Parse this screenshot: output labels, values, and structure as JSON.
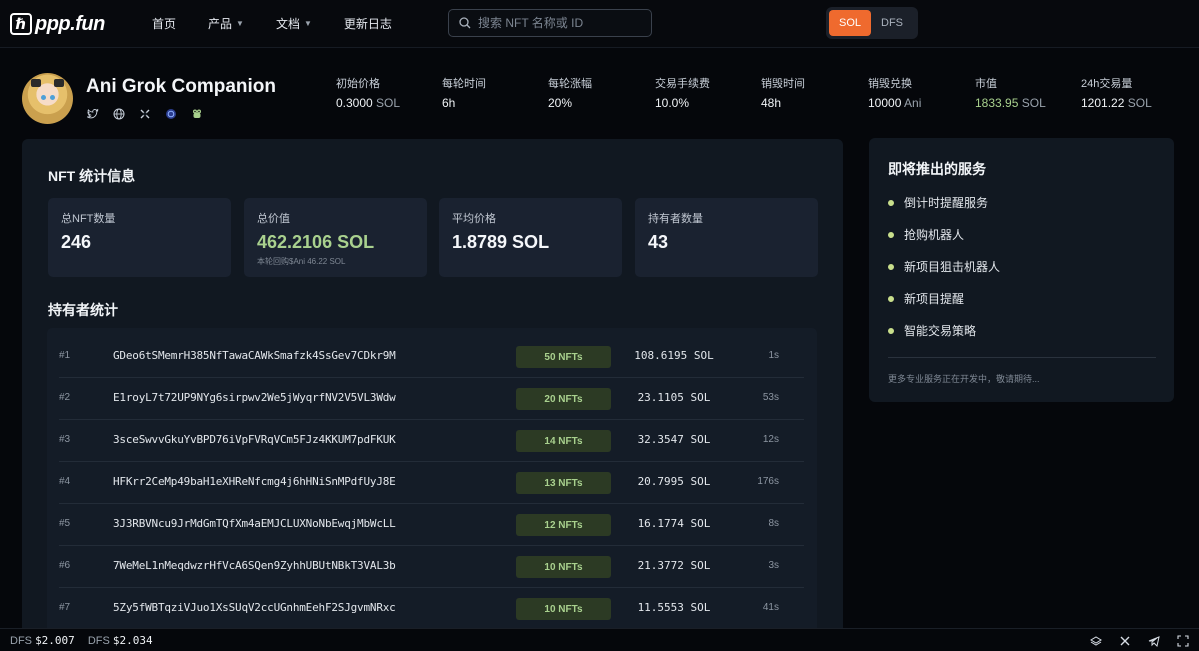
{
  "header": {
    "logo_mark": "ℏ",
    "logo_text": "ppp.fun",
    "nav": [
      {
        "label": "首页",
        "has_dropdown": false
      },
      {
        "label": "产品",
        "has_dropdown": true
      },
      {
        "label": "文档",
        "has_dropdown": true
      },
      {
        "label": "更新日志",
        "has_dropdown": false
      }
    ],
    "search_placeholder": "搜索 NFT 名称或 ID",
    "currency_toggle": {
      "options": [
        "SOL",
        "DFS"
      ],
      "selected": "SOL"
    }
  },
  "project": {
    "name": "Ani Grok Companion",
    "social_icons": [
      "twitter-icon",
      "globe-icon",
      "x-icon",
      "token-icon",
      "frog-icon"
    ],
    "stats": [
      {
        "label": "初始价格",
        "value": "0.3000",
        "unit": "SOL"
      },
      {
        "label": "每轮时间",
        "value": "6h",
        "unit": ""
      },
      {
        "label": "每轮涨幅",
        "value": "20%",
        "unit": ""
      },
      {
        "label": "交易手续费",
        "value": "10.0%",
        "unit": ""
      },
      {
        "label": "销毁时间",
        "value": "48h",
        "unit": ""
      },
      {
        "label": "销毁兑换",
        "value": "10000",
        "unit": "Ani"
      },
      {
        "label": "市值",
        "value": "1833.95",
        "unit": "SOL",
        "accent": true
      },
      {
        "label": "24h交易量",
        "value": "1201.22",
        "unit": "SOL"
      }
    ]
  },
  "nft_stats": {
    "title": "NFT 统计信息",
    "cards": [
      {
        "label": "总NFT数量",
        "value": "246",
        "sub": ""
      },
      {
        "label": "总价值",
        "value": "462.2106 SOL",
        "sub": "本轮回购$Ani 46.22 SOL",
        "accent": true
      },
      {
        "label": "平均价格",
        "value": "1.8789 SOL",
        "sub": ""
      },
      {
        "label": "持有者数量",
        "value": "43",
        "sub": ""
      }
    ]
  },
  "holders": {
    "title": "持有者统计",
    "rows": [
      {
        "rank": "#1",
        "address": "GDeo6tSMemrH385NfTawaCAWkSmafzk4SsGev7CDkr9M",
        "nfts": "50 NFTs",
        "sol": "108.6195 SOL",
        "time": "1s"
      },
      {
        "rank": "#2",
        "address": "E1royL7t72UP9NYg6sirpwv2We5jWyqrfNV2V5VL3Wdw",
        "nfts": "20 NFTs",
        "sol": "23.1105 SOL",
        "time": "53s"
      },
      {
        "rank": "#3",
        "address": "3sceSwvvGkuYvBPD76iVpFVRqVCm5FJz4KKUM7pdFKUK",
        "nfts": "14 NFTs",
        "sol": "32.3547 SOL",
        "time": "12s"
      },
      {
        "rank": "#4",
        "address": "HFKrr2CeMp49baH1eXHReNfcmg4j6hHNiSnMPdfUyJ8E",
        "nfts": "13 NFTs",
        "sol": "20.7995 SOL",
        "time": "176s"
      },
      {
        "rank": "#5",
        "address": "3J3RBVNcu9JrMdGmTQfXm4aEMJCLUXNoNbEwqjMbWcLL",
        "nfts": "12 NFTs",
        "sol": "16.1774 SOL",
        "time": "8s"
      },
      {
        "rank": "#6",
        "address": "7WeMeL1nMeqdwzrHfVcA6SQen9ZyhhUBUtNBkT3VAL3b",
        "nfts": "10 NFTs",
        "sol": "21.3772 SOL",
        "time": "3s"
      },
      {
        "rank": "#7",
        "address": "5Zy5fWBTqziVJuo1XsSUqV2ccUGnhmEehF2SJgvmNRxc",
        "nfts": "10 NFTs",
        "sol": "11.5553 SOL",
        "time": "41s"
      }
    ]
  },
  "upcoming": {
    "title": "即将推出的服务",
    "services": [
      "倒计时提醒服务",
      "抢购机器人",
      "新项目狙击机器人",
      "新项目提醒",
      "智能交易策略"
    ],
    "note": "更多专业服务正在开发中，敬请期待..."
  },
  "footer": {
    "tickers": [
      {
        "symbol": "DFS",
        "price": "$2.007"
      },
      {
        "symbol": "DFS",
        "price": "$2.034"
      }
    ],
    "icons": [
      "gitbook-icon",
      "x-icon",
      "telegram-icon",
      "expand-icon"
    ]
  }
}
